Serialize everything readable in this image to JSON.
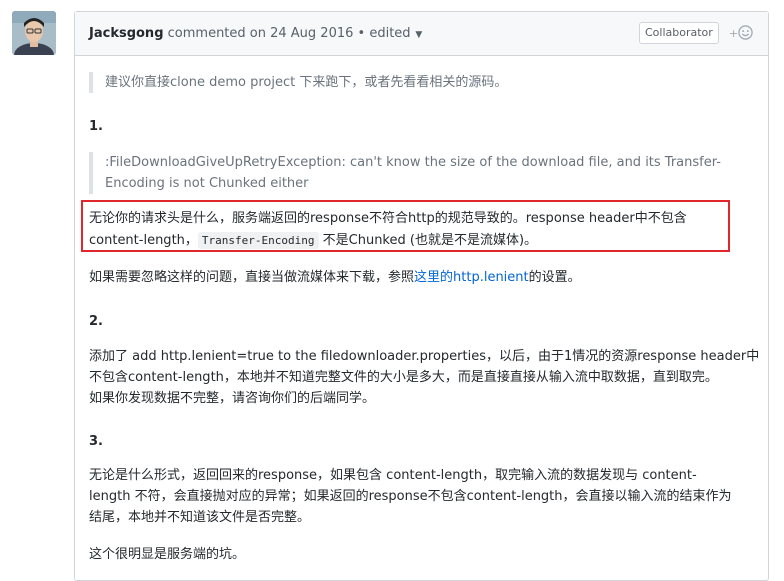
{
  "comment": {
    "author": "Jacksgong",
    "commented_on": "commented on 24 Aug 2016",
    "separator": "•",
    "edited_label": "edited",
    "badge": "Collaborator",
    "reaction_icon": "smiley-plus-icon"
  },
  "body": {
    "quote1": "建议你直接clone demo project 下来跑下，或者先看看相关的源码。",
    "num1": "1.",
    "quote2_line1": ":FileDownloadGiveUpRetryException: can't know the size of the download file, and its Transfer-",
    "quote2_line2": "Encoding is not Chunked either",
    "hl_line1": "无论你的请求头是什么，服务端返回的response不符合http的规范导致的。response header中不包含",
    "hl_line2_pre": "content-length，",
    "hl_code": "Transfer-Encoding",
    "hl_line2_post": "不是Chunked (也就是不是流媒体)。",
    "p1_pre": "如果需要忽略这样的问题，直接当做流媒体来下载，参照",
    "p1_link": "这里的http.lenient",
    "p1_post": "的设置。",
    "num2": "2.",
    "p2_line1": "添加了 add http.lenient=true to the filedownloader.properties，以后，由于1情况的资源response header中",
    "p2_line2": "不包含content-length，本地并不知道完整文件的大小是多大，而是直接直接从输入流中取数据，直到取完。",
    "p2_line3": "如果你发现数据不完整，请咨询你们的后端同学。",
    "num3": "3.",
    "p3_line1": "无论是什么形式，返回回来的response，如果包含 content-length，取完输入流的数据发现与 content-",
    "p3_line2": "length 不符，会直接抛对应的异常；如果返回的response不包含content-length，会直接以输入流的结束作为",
    "p3_line3": "结尾，本地并不知道该文件是否完整。",
    "p4": "这个很明显是服务端的坑。"
  }
}
